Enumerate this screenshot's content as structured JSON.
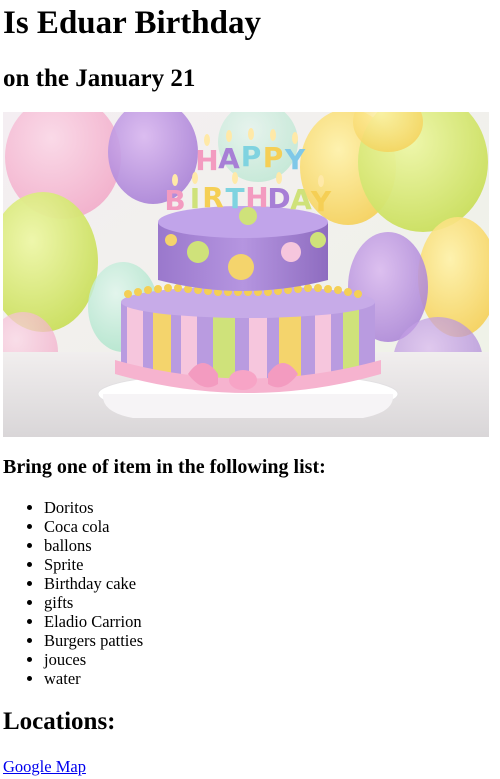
{
  "header": {
    "title": "Is Eduar Birthday",
    "subtitle": "on the January 21"
  },
  "image": {
    "alt": "birthday-cake",
    "topper_text": "HAPPY BIRTHDAY",
    "topper_line1": "HAPPY",
    "topper_line2": "BIRTHDAY"
  },
  "list": {
    "heading": "Bring one of item in the following list:",
    "items": [
      "Doritos",
      "Coca cola",
      "ballons",
      "Sprite",
      "Birthday cake",
      "gifts",
      "Eladio Carrion",
      "Burgers patties",
      "jouces",
      "water"
    ]
  },
  "locations": {
    "heading": "Locations:",
    "link_label": "Google Map"
  },
  "colors": {
    "link": "#0000ee",
    "text": "#000000"
  }
}
